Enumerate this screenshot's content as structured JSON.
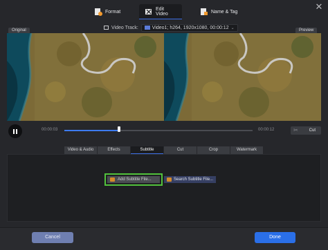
{
  "window": {
    "close_glyph": "✕"
  },
  "top_tabs": [
    {
      "label": "Format",
      "icon": "format-icon"
    },
    {
      "label": "Edit Video",
      "icon": "edit-video-icon",
      "active": true
    },
    {
      "label": "Name & Tag",
      "icon": "name-tag-icon"
    }
  ],
  "video_track": {
    "label": "Video Track:",
    "value": "Video1; h264, 1920x1080, 00:00:12"
  },
  "panes": {
    "original_label": "Original",
    "preview_label": "Preview"
  },
  "playback": {
    "current_time": "00:00:03",
    "end_time": "00:00:12",
    "progress": 0.29,
    "cut_label": "Cut"
  },
  "edit_tabs": [
    {
      "label": "Video & Audio"
    },
    {
      "label": "Effects"
    },
    {
      "label": "Subtitle",
      "active": true
    },
    {
      "label": "Cut"
    },
    {
      "label": "Crop"
    },
    {
      "label": "Watermark"
    }
  ],
  "subtitle": {
    "add_label": "Add Subtitle File...",
    "search_label": "Search Subtitle File..."
  },
  "footer": {
    "cancel_label": "Cancel",
    "done_label": "Done"
  },
  "colors": {
    "accent": "#2a6fe8",
    "highlight_border": "#52c23c",
    "subtitle_icon": "#d58a2a"
  }
}
